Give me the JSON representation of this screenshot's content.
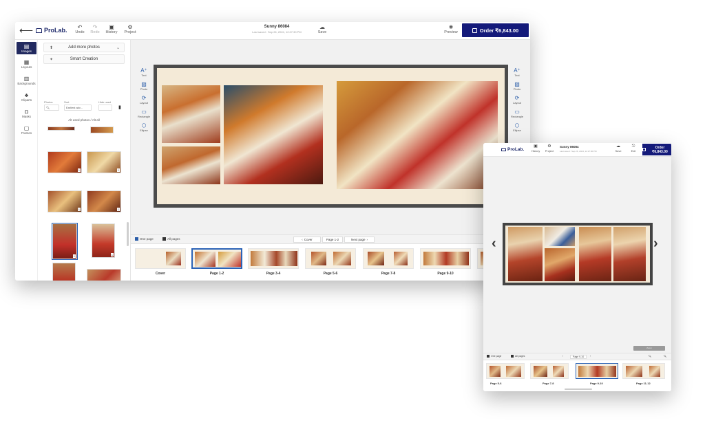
{
  "desktop": {
    "topbar": {
      "back_icon": "arrow-left-icon",
      "logo": "ProLab.",
      "undo": "Undo",
      "redo": "Redo",
      "history": "History",
      "project": "Project",
      "doc_title": "Sunny 86084",
      "doc_subtitle": "Last saved : Sep 26, 2024, 12:27:30 PM",
      "save": "Save",
      "preview": "Preview",
      "order_label": "Order ₹6,843.00"
    },
    "rail": [
      "Images",
      "Layouts",
      "Backgrounds",
      "Cliparts",
      "Masks",
      "Frames"
    ],
    "panel": {
      "add_more": "Add more photos",
      "smart_creation": "Smart Creation",
      "filter_labels": {
        "photos": "Photos",
        "sort": "Sort",
        "hide_used": "Hide used"
      },
      "sort_value": "Earliest adv...",
      "used_note": "Alt used photos / Alt all"
    },
    "tools_left": [
      "Text",
      "Photo",
      "Layout",
      "Rectangle",
      "Ellipse"
    ],
    "tools_right": [
      "Text",
      "Photo",
      "Layout",
      "Rectangle",
      "Ellipse"
    ],
    "pagebar": {
      "one_page": "One page",
      "all_pages": "All pages",
      "cover": "Cover",
      "current": "Page 1-2",
      "next_page": "Next page"
    },
    "strip_labels": [
      "Cover",
      "Page 1-2",
      "Page 3-4",
      "Page 5-6",
      "Page 7-8",
      "Page 9-10"
    ]
  },
  "tablet": {
    "logo": "ProLab.",
    "history": "History",
    "project": "Project",
    "title": "Sunny 86084",
    "subtitle": "Last saved : Sep 26, 2024, 12:27:30 PM",
    "save": "Save",
    "exit": "Exit",
    "order_label": "Order ₹6,843.00",
    "pagebar": {
      "one_page": "One page",
      "all_pages": "All pages",
      "current": "Page 9-10"
    },
    "zoom_label": "Zoom",
    "strip_labels": [
      "Page 5-6",
      "Page 7-8",
      "Page 9-10",
      "Page 11-12"
    ]
  }
}
